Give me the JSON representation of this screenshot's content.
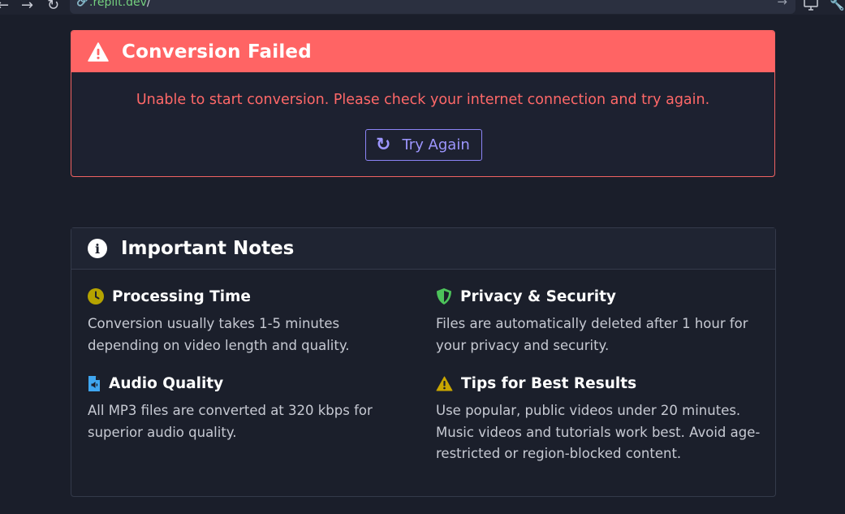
{
  "browser": {
    "url_text": ".replit.dev",
    "url_slash": "/"
  },
  "error": {
    "title": "Conversion Failed",
    "message": "Unable to start conversion. Please check your internet connection and try again.",
    "retry_label": "Try Again",
    "colors": {
      "header": "#ff6464",
      "message": "#ff6868",
      "button": "#9d96ff"
    }
  },
  "notes": {
    "title": "Important Notes",
    "items": [
      {
        "icon": "clock-icon",
        "title": "Processing Time",
        "body": "Conversion usually takes 1-5 minutes depending on video length and quality."
      },
      {
        "icon": "shield-icon",
        "title": "Privacy & Security",
        "body": "Files are automatically deleted after 1 hour for your privacy and security."
      },
      {
        "icon": "audio-file-icon",
        "title": "Audio Quality",
        "body": "All MP3 files are converted at 320 kbps for superior audio quality."
      },
      {
        "icon": "warning-icon",
        "title": "Tips for Best Results",
        "body": "Use popular, public videos under 20 minutes. Music videos and tutorials work best. Avoid age-restricted or region-blocked content."
      }
    ]
  }
}
